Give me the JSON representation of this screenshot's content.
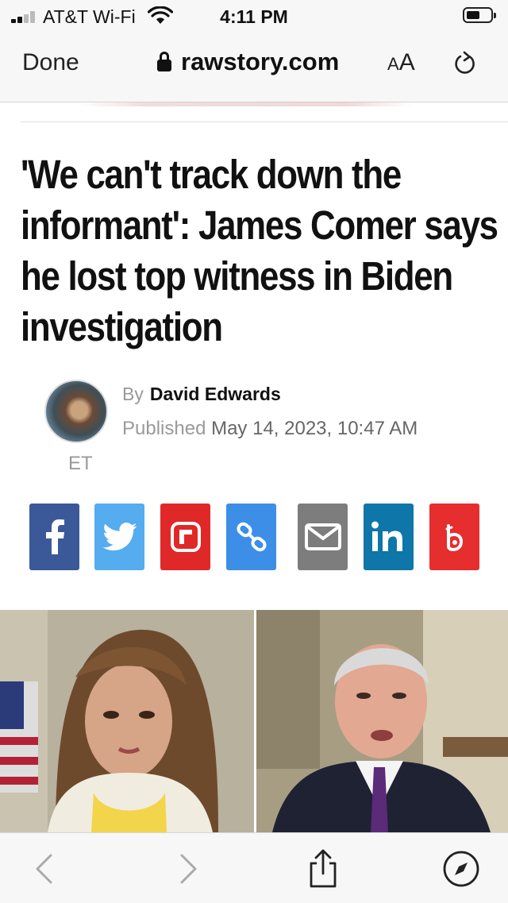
{
  "status_bar": {
    "carrier": "AT&T Wi-Fi",
    "time": "4:11 PM"
  },
  "browser": {
    "done_label": "Done",
    "domain": "rawstory.com",
    "text_size_label_small": "A",
    "text_size_label_large": "A"
  },
  "article": {
    "headline": "'We can't track down the informant': James Comer says he lost top witness in Biden investigation",
    "by_label": "By",
    "author": "David Edwards",
    "published_label": "Published",
    "published_date": "May 14, 2023, 10:47 AM",
    "timezone": "ET"
  },
  "share_buttons": [
    {
      "name": "facebook",
      "color": "#3b5998",
      "icon": "facebook-icon"
    },
    {
      "name": "twitter",
      "color": "#55acee",
      "icon": "twitter-icon"
    },
    {
      "name": "flipboard",
      "color": "#e12828",
      "icon": "flipboard-icon"
    },
    {
      "name": "copy-link",
      "color": "#3d8ee6",
      "icon": "link-icon"
    },
    {
      "name": "email",
      "color": "#7d7d7d",
      "icon": "email-icon"
    },
    {
      "name": "linkedin",
      "color": "#0e76a8",
      "icon": "linkedin-icon"
    },
    {
      "name": "beehiiv",
      "color": "#e62e2e",
      "icon": "brand-icon"
    }
  ],
  "colors": {
    "chrome_bg": "#f7f7f7",
    "text": "#111111",
    "muted": "#999999"
  }
}
